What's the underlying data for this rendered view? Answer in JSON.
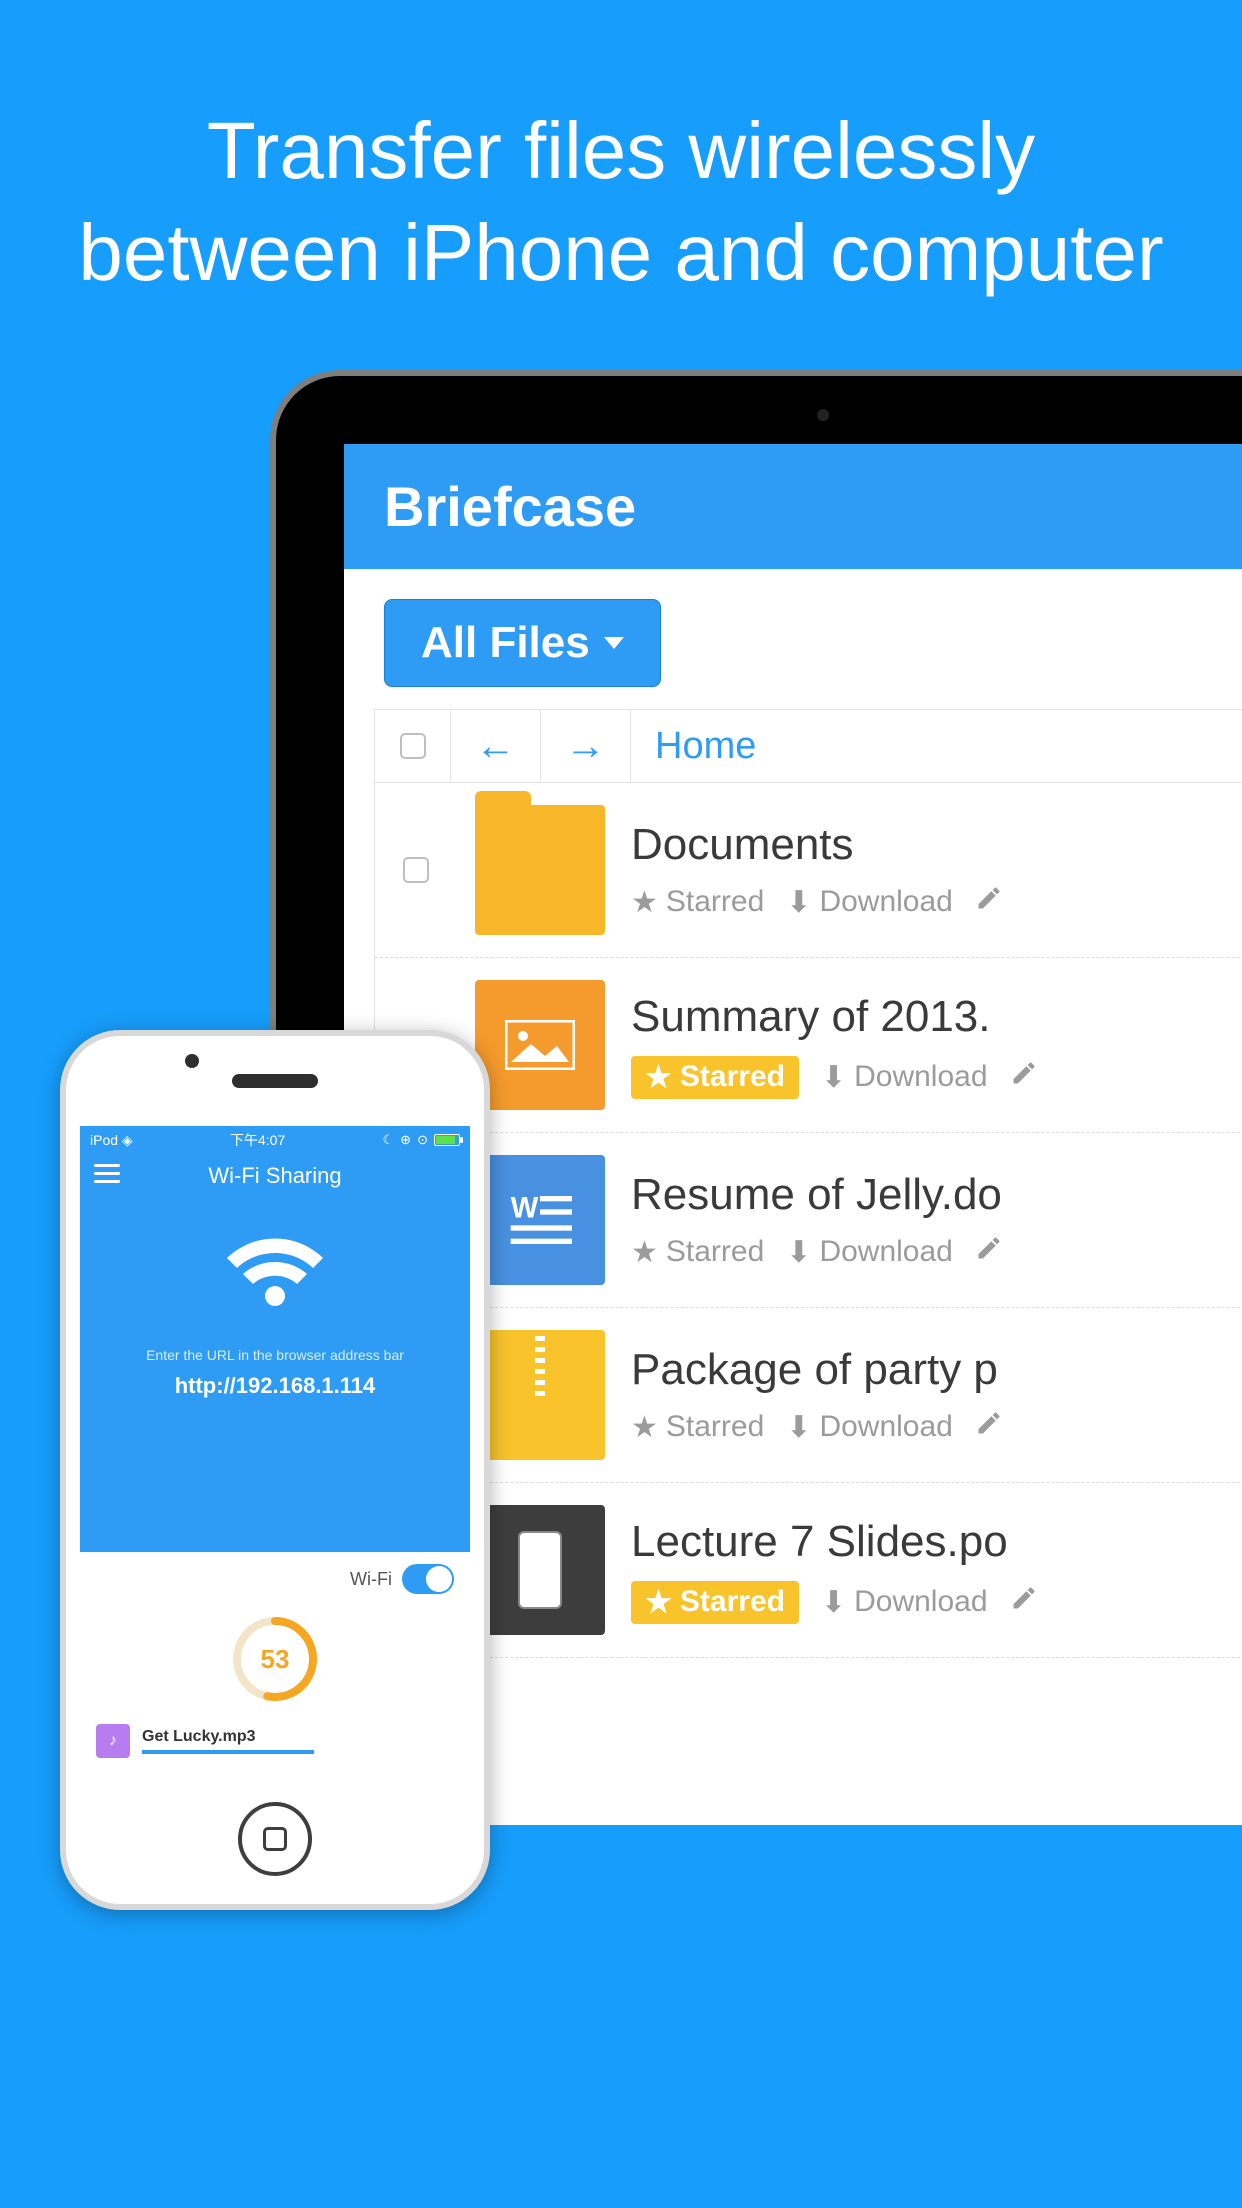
{
  "hero": {
    "line1": "Transfer files wirelessly",
    "line2": "between iPhone and computer"
  },
  "laptop": {
    "app_title": "Briefcase",
    "dropdown_label": "All Files",
    "breadcrumb": "Home",
    "action_labels": {
      "starred": "Starred",
      "download": "Download"
    },
    "files": [
      {
        "name": "Documents",
        "starred": false,
        "type": "folder"
      },
      {
        "name": "Summary of 2013.",
        "starred": true,
        "type": "image"
      },
      {
        "name": "Resume of Jelly.do",
        "starred": false,
        "type": "doc"
      },
      {
        "name": "Package of party p",
        "starred": false,
        "type": "zip"
      },
      {
        "name": "Lecture 7 Slides.po",
        "starred": true,
        "type": "lecture"
      }
    ]
  },
  "phone": {
    "status": {
      "carrier": "iPod",
      "time": "下午4:07"
    },
    "title": "Wi-Fi Sharing",
    "hint": "Enter the URL in the browser address bar",
    "url": "http://192.168.1.114",
    "wifi_label": "Wi-Fi",
    "progress": "53",
    "transfer_file": "Get Lucky.mp3"
  }
}
